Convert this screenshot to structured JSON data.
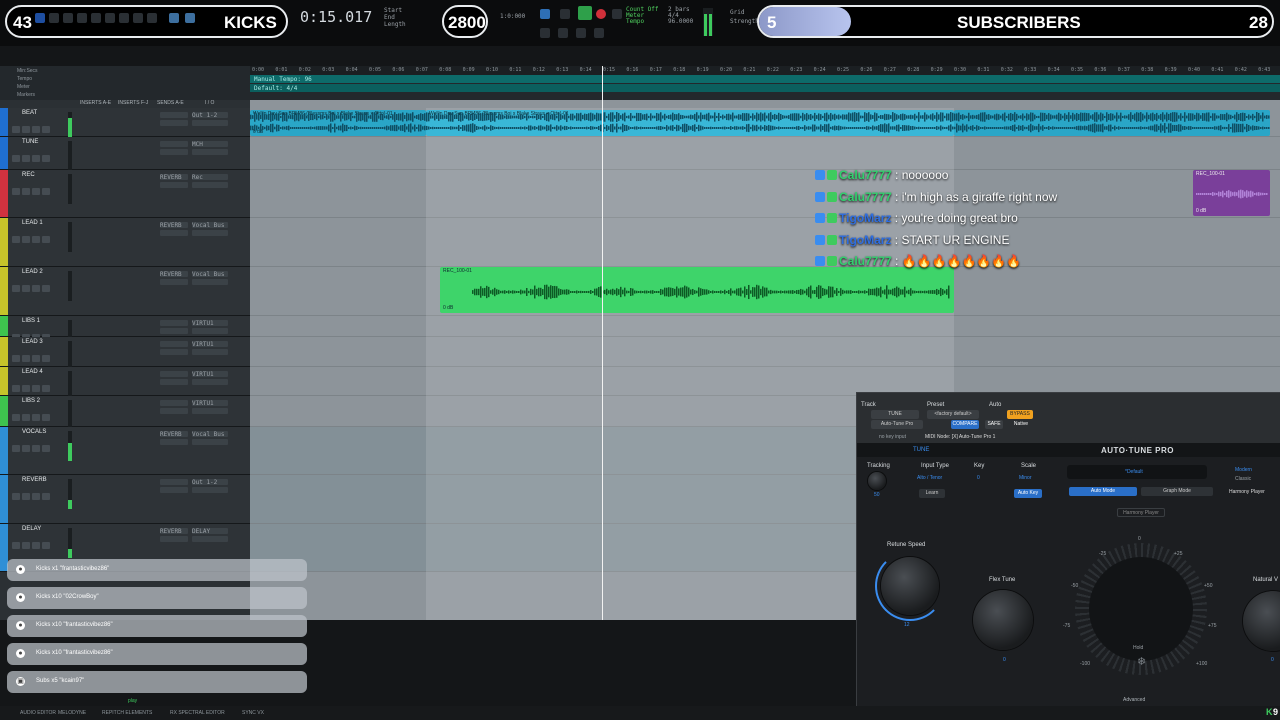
{
  "overlay": {
    "kicks_count": "43",
    "kicks_label": "KICKS",
    "kicks_goal": "2800",
    "subs_count": "5",
    "subs_label": "SUBSCRIBERS",
    "subs_goal": "28",
    "subs_progress": 0.179
  },
  "transport": {
    "counter": "0:15.017",
    "time_small": "1:0:000",
    "start_label": "Start",
    "end_label": "End",
    "length_label": "Length",
    "grid_label": "Grid",
    "strength_label": "Strength",
    "count_off": "Count Off",
    "meter_label": "Meter",
    "tempo_label": "Tempo",
    "tempo_value": "96.0000",
    "bars": "2 bars",
    "sig": "4/4"
  },
  "rulers": {
    "rows": [
      "Min:Secs",
      "Tempo",
      "Meter",
      "Markers"
    ],
    "ticks": [
      "0:00",
      "0:01",
      "0:02",
      "0:03",
      "0:04",
      "0:05",
      "0:06",
      "0:07",
      "0:08",
      "0:09",
      "0:10",
      "0:11",
      "0:12",
      "0:13",
      "0:14",
      "0:15",
      "0:16",
      "0:17",
      "0:18",
      "0:19",
      "0:20",
      "0:21",
      "0:22",
      "0:23",
      "0:24",
      "0:25",
      "0:26",
      "0:27",
      "0:28",
      "0:29",
      "0:30",
      "0:31",
      "0:32",
      "0:33",
      "0:34",
      "0:35",
      "0:36",
      "0:37",
      "0:38",
      "0:39",
      "0:40",
      "0:41",
      "0:42",
      "0:43"
    ],
    "tempo_text": "Manual Tempo: 96",
    "meter_text": "Default: 4/4"
  },
  "columns": {
    "inserts_ae": "INSERTS A-E",
    "inserts_fj": "INSERTS F-J",
    "sends_ae": "SENDS A-E",
    "io": "I / O"
  },
  "tracks": [
    {
      "name": "BEAT",
      "color": "#1f6fd1",
      "insert": "",
      "io": "Out 1-2",
      "meter": 0.8
    },
    {
      "name": "TUNE",
      "color": "#1f6fd1",
      "insert": "",
      "io": "MCH",
      "meter": 0
    },
    {
      "name": "REC",
      "color": "#d1323f",
      "insert": "REVERB",
      "io": "Rec",
      "meter": 0
    },
    {
      "name": "LEAD 1",
      "color": "#c6c32a",
      "insert": "REVERB",
      "io": "Vocal Bus",
      "meter": 0
    },
    {
      "name": "LEAD 2",
      "color": "#c6c32a",
      "insert": "REVERB",
      "io": "Vocal Bus",
      "meter": 0
    },
    {
      "name": "LIBS 1",
      "color": "#3ec34e",
      "insert": "",
      "io": "VIRTU1",
      "meter": 0
    },
    {
      "name": "LEAD 3",
      "color": "#c6c32a",
      "insert": "",
      "io": "VIRTU1",
      "meter": 0
    },
    {
      "name": "LEAD 4",
      "color": "#c6c32a",
      "insert": "",
      "io": "VIRTU1",
      "meter": 0
    },
    {
      "name": "LIBS 2",
      "color": "#3ec34e",
      "insert": "",
      "io": "VIRTU1",
      "meter": 0
    },
    {
      "name": "VOCALS",
      "color": "#2f8fd6",
      "insert": "REVERB",
      "io": "Vocal Bus",
      "meter": 0.6
    },
    {
      "name": "REVERB",
      "color": "#2f8fd6",
      "insert": "",
      "io": "Out 1-2",
      "meter": 0.3
    },
    {
      "name": "DELAY",
      "color": "#2f8fd6",
      "insert": "REVERB",
      "io": "DELAY",
      "meter": 0.3
    }
  ],
  "clips": {
    "beat": "Wellin Day Sup BPM86 (Blessms Boi x Blake Straus x Otto)-01",
    "lead2": "REC_100-01",
    "rec": "REC_100-01",
    "db": "0 dB"
  },
  "chat": [
    {
      "user": "Calu7777",
      "user_color": "#32d06e",
      "text": " : noooooo"
    },
    {
      "user": "Calu7777",
      "user_color": "#32d06e",
      "text": " : i'm high as a giraffe right now"
    },
    {
      "user": "TigoMarz",
      "user_color": "#2f6ee0",
      "text": " : you're doing great bro"
    },
    {
      "user": "TigoMarz",
      "user_color": "#2f6ee0",
      "text": " : START UR ENGINE"
    },
    {
      "user": "Calu7777",
      "user_color": "#32d06e",
      "text": " : 🔥🔥🔥🔥🔥🔥🔥🔥"
    }
  ],
  "alerts": [
    {
      "text": "Kicks x1 \"frantasticvibez86\"",
      "icon": "k"
    },
    {
      "text": "Kicks x10 \"02CrowBoy\"",
      "icon": "k"
    },
    {
      "text": "Kicks x10 \"frantasticvibez86\"",
      "icon": "k"
    },
    {
      "text": "Kicks x10 \"frantasticvibez86\"",
      "icon": "k"
    },
    {
      "text": "Subs x5 \"kcain97\"",
      "icon": "gift"
    }
  ],
  "autotune": {
    "track_label": "Track",
    "preset_label": "Preset",
    "auto_label": "Auto",
    "track_name": "TUNE",
    "plugin_name": "Auto-Tune Pro",
    "preset_name": "<factory default>",
    "compare": "COMPARE",
    "safe": "SAFE",
    "bypass": "BYPASS",
    "native": "Native",
    "key_input": "no key input",
    "midi_node": "MIDI Node: [X] Auto-Tune Pro 1",
    "brand": "AUTO·TUNE PRO",
    "tune_tab": "TUNE",
    "tracking_label": "Tracking",
    "tracking_value": "50",
    "input_type_label": "Input Type",
    "input_type_value": "Alto / Tenor",
    "learn": "Learn",
    "key_label": "Key",
    "key_value": "0",
    "scale_label": "Scale",
    "scale_value": "Minor",
    "auto_key": "Auto Key",
    "preset_display": "*Default",
    "modern": "Modern",
    "classic": "Classic",
    "auto_mode": "Auto Mode",
    "graph_mode": "Graph Mode",
    "harmony_player": "Harmony Player",
    "harmony_btn": "Harmony Player",
    "retune_label": "Retune Speed",
    "retune_value": "12",
    "flex_label": "Flex Tune",
    "flex_value": "0",
    "natural_label": "Natural V",
    "natural_value": "0",
    "hold": "Hold",
    "advanced": "Advanced",
    "dial_marks": [
      "0",
      "-25",
      "+25",
      "-50",
      "+50",
      "-75",
      "+75",
      "-100",
      "+100"
    ]
  },
  "bottom": {
    "items": [
      "AUDIO EDITOR",
      "MELODYNE",
      "REPITCH ELEMENTS",
      "RX SPECTRAL EDITOR",
      "SYNC VX"
    ],
    "play": "play",
    "k_badge": "9"
  }
}
